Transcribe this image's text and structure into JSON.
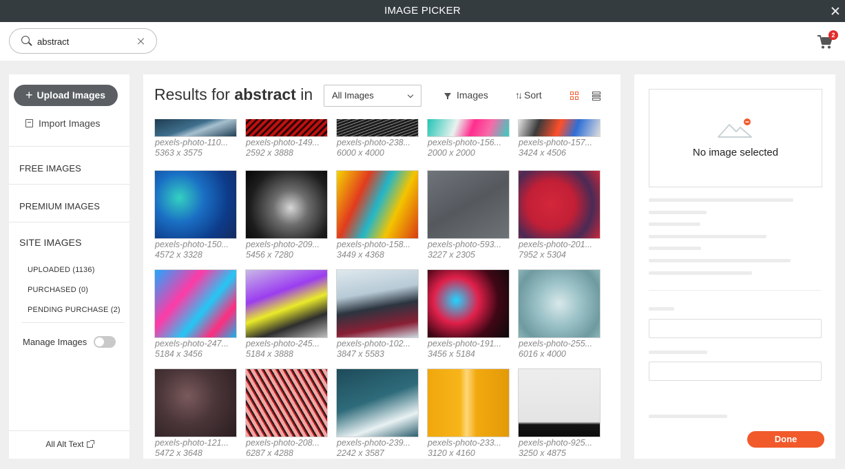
{
  "app": {
    "title": "IMAGE PICKER"
  },
  "search": {
    "value": "abstract"
  },
  "cart": {
    "count": "2"
  },
  "sidebar": {
    "upload_label": "Upload Images",
    "import_label": "Import Images",
    "free_images": "FREE IMAGES",
    "premium_images": "PREMIUM IMAGES",
    "site_images": "SITE IMAGES",
    "uploaded": "UPLOADED (1136)",
    "purchased": "PURCHASED (0)",
    "pending_purchase": "PENDING PURCHASE (2)",
    "manage_images": "Manage Images",
    "all_alt_text": "All Alt Text"
  },
  "results": {
    "prefix": "Results for",
    "query": "abstract",
    "suffix": "in",
    "filter_value": "All Images",
    "images_filter_label": "Images",
    "sort_label": "Sort"
  },
  "images": [
    {
      "name": "pexels-photo-110...",
      "dims": "5363 x 3575",
      "bg": "linear-gradient(160deg,#1d3a4f 0%,#3f6f8d 45%,#a7c0cf 60%,#1f3e53 100%)"
    },
    {
      "name": "pexels-photo-149...",
      "dims": "2592 x 3888",
      "bg": "repeating-linear-gradient(135deg,#c01010 0px,#c01010 4px,#2a0505 4px,#2a0505 7px)"
    },
    {
      "name": "pexels-photo-238...",
      "dims": "6000 x 4000",
      "bg": "repeating-linear-gradient(160deg,#1b1b1b 0px,#1b1b1b 3px,#8a8a8a 3px,#8a8a8a 4px)"
    },
    {
      "name": "pexels-photo-156...",
      "dims": "2000 x 2000",
      "bg": "linear-gradient(110deg,#20c4b5 0%,#e9f2ee 35%,#ff2d8f 55%,#f76aa8 75%,#30d0c0 100%)"
    },
    {
      "name": "pexels-photo-157...",
      "dims": "3424 x 4506",
      "bg": "linear-gradient(110deg,#e8e8e8 0%,#3a3a3a 25%,#ff4f2a 50%,#2e6fd6 70%,#dddddd 100%)"
    },
    {
      "name": "pexels-photo-150...",
      "dims": "4572 x 3328",
      "bg": "radial-gradient(circle at 30% 40%,#34d1c2 0%,#1a6fc4 35%,#0d3b8a 70%,#142a5e 100%)"
    },
    {
      "name": "pexels-photo-209...",
      "dims": "5456 x 7280",
      "bg": "radial-gradient(circle at 55% 55%,#d7d7d7 0%,#6d6d6d 30%,#1d1d1d 70%,#050505 100%)"
    },
    {
      "name": "pexels-photo-158...",
      "dims": "3449 x 4368",
      "bg": "linear-gradient(115deg,#f5d400 0%,#e23b1e 30%,#22b6c9 50%,#f4c400 70%,#d93a14 100%)"
    },
    {
      "name": "pexels-photo-593...",
      "dims": "3227 x 2305",
      "bg": "linear-gradient(150deg,#6f747a 0%,#55595e 50%,#6e7378 100%)"
    },
    {
      "name": "pexels-photo-201...",
      "dims": "7952 x 5304",
      "bg": "radial-gradient(circle at 40% 50%,#d3273b 0%,#c21f36 40%,#4a2a55 70%,#c9283c 100%)"
    },
    {
      "name": "pexels-photo-247...",
      "dims": "5184 x 3456",
      "bg": "linear-gradient(130deg,#1fa8ff 0%,#ff3aa6 35%,#23c7f5 60%,#ff2d7e 80%,#14b3e8 100%)"
    },
    {
      "name": "pexels-photo-245...",
      "dims": "5184 x 3888",
      "bg": "linear-gradient(160deg,#c9b8e6 0%,#9b3df0 35%,#eaea2a 55%,#2e2e2e 75%,#bdbdbd 100%)"
    },
    {
      "name": "pexels-photo-102...",
      "dims": "3847 x 5583",
      "bg": "linear-gradient(170deg,#dfe8ee 0%,#b7cad6 35%,#2b3540 55%,#8a1f35 80%,#cbd9e2 100%)"
    },
    {
      "name": "pexels-photo-191...",
      "dims": "3456 x 5184",
      "bg": "radial-gradient(circle at 35% 45%,#22d4ff 0%,#e0204a 35%,#400716 65%,#0a0a0a 100%)"
    },
    {
      "name": "pexels-photo-255...",
      "dims": "6016 x 4000",
      "bg": "radial-gradient(circle at 50% 50%,#d9e8ea 0%,#9cc3c8 40%,#6e9aa0 80%,#8bb5b8 100%)"
    },
    {
      "name": "pexels-photo-121...",
      "dims": "5472 x 3648",
      "bg": "radial-gradient(circle at 40% 40%,#7a5a5c 0%,#4a3538 45%,#2a1d20 100%)"
    },
    {
      "name": "pexels-photo-208...",
      "dims": "6287 x 4288",
      "bg": "repeating-linear-gradient(60deg,#f0a6a2 0px,#f0a6a2 5px,#c01b22 5px,#c01b22 7px,#1b1b1b 7px,#1b1b1b 9px)"
    },
    {
      "name": "pexels-photo-239...",
      "dims": "2242 x 3587",
      "bg": "linear-gradient(160deg,#1e4b5a 0%,#2e6b7a 45%,#e8f1f3 75%,#2b5e6d 100%)"
    },
    {
      "name": "pexels-photo-233...",
      "dims": "3120 x 4160",
      "bg": "linear-gradient(90deg,#f0a70d 0%,#f7b51a 40%,#ffd77a 48%,#f2a90f 60%,#e39a08 100%)"
    },
    {
      "name": "pexels-photo-925...",
      "dims": "3250 x 4875",
      "bg": "linear-gradient(180deg,#ededed 0%,#e4e4e4 78%,#141414 82%,#0c0c0c 100%)"
    }
  ],
  "detail": {
    "no_image": "No image selected",
    "done_label": "Done"
  }
}
